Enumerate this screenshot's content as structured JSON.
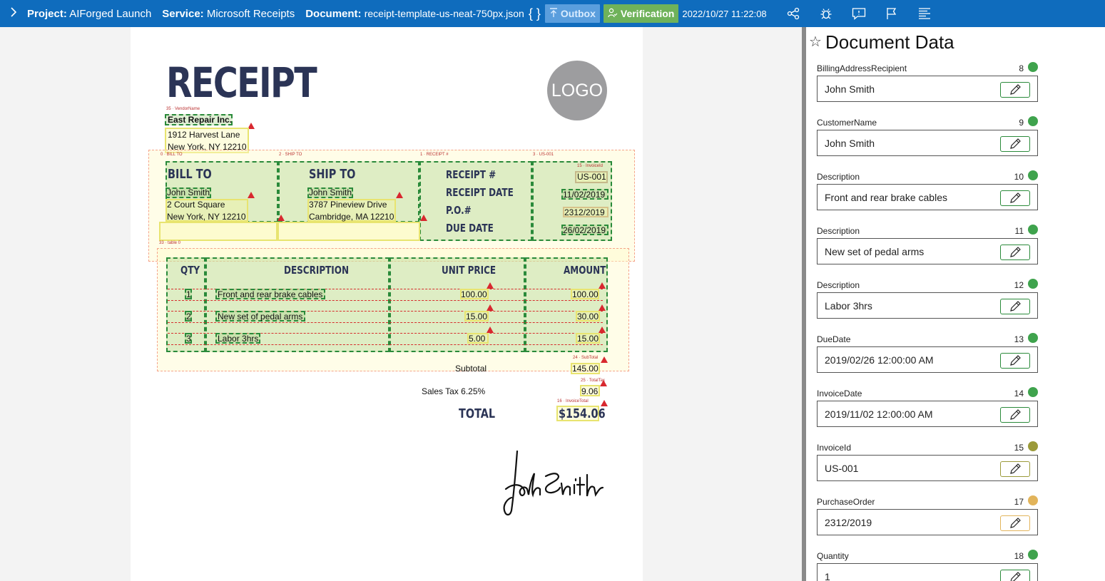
{
  "header": {
    "project_label": "Project:",
    "project": "AIForged Launch",
    "service_label": "Service:",
    "service": "Microsoft Receipts",
    "document_label": "Document:",
    "document": "receipt-template-us-neat-750px.json",
    "braces": "{ }",
    "outbox": "Outbox",
    "verification": "Verification",
    "timestamp": "2022/10/27 11:22:08"
  },
  "receipt": {
    "title": "RECEIPT",
    "logo": "LOGO",
    "vendor_name": "East Repair Inc.",
    "vendor_addr1": "1912 Harvest Lane",
    "vendor_addr2": "New York, NY 12210",
    "bill_to": "BILL TO",
    "ship_to": "SHIP TO",
    "receipt_no_label": "RECEIPT #",
    "receipt_date_label": "RECEIPT DATE",
    "po_label": "P.O.#",
    "due_date_label": "DUE DATE",
    "bill_name": "John Smith",
    "bill_addr1": "2 Court Square",
    "bill_addr2": "New York, NY 12210",
    "ship_name": "John Smith",
    "ship_addr1": "3787 Pineview Drive",
    "ship_addr2": "Cambridge, MA 12210",
    "receipt_no": "US-001",
    "receipt_date": "11/02/2019",
    "po": "2312/2019",
    "due_date": "26/02/2019",
    "col_qty": "QTY",
    "col_desc": "DESCRIPTION",
    "col_price": "UNIT PRICE",
    "col_amount": "AMOUNT",
    "items": [
      {
        "qty": "1",
        "desc": "Front and rear brake cables",
        "price": "100.00",
        "amount": "100.00"
      },
      {
        "qty": "2",
        "desc": "New set of pedal arms",
        "price": "15.00",
        "amount": "30.00"
      },
      {
        "qty": "3",
        "desc": "Labor 3hrs",
        "price": "5.00",
        "amount": "15.00"
      }
    ],
    "subtotal_label": "Subtotal",
    "subtotal": "145.00",
    "tax_label": "Sales Tax 6.25%",
    "tax": "9.06",
    "total_label": "TOTAL",
    "total": "$154.06",
    "tags": {
      "vendor": "35 · VendorName",
      "bill_to": "0 · BILL TO",
      "ship_to": "2 · SHIP TO",
      "receipt": "1 · RECEIPT #",
      "us": "3 · US-001",
      "invoice_id": "15 · InvoiceId",
      "table": "33 · table 0",
      "subtotal": "24 · SubTotal",
      "tax": "25 · TotalTax",
      "invoice_total": "16 · InvoiceTotal"
    }
  },
  "panel": {
    "title": "Document Data",
    "fields": [
      {
        "name": "BillingAddressRecipient",
        "num": "8",
        "value": "John Smith",
        "status": "#3fa34d"
      },
      {
        "name": "CustomerName",
        "num": "9",
        "value": "John Smith",
        "status": "#3fa34d"
      },
      {
        "name": "Description",
        "num": "10",
        "value": "Front and rear brake cables",
        "status": "#3fa34d"
      },
      {
        "name": "Description",
        "num": "11",
        "value": "New set of pedal arms",
        "status": "#3fa34d"
      },
      {
        "name": "Description",
        "num": "12",
        "value": "Labor 3hrs",
        "status": "#3fa34d"
      },
      {
        "name": "DueDate",
        "num": "13",
        "value": "2019/02/26 12:00:00 AM",
        "status": "#3fa34d"
      },
      {
        "name": "InvoiceDate",
        "num": "14",
        "value": "2019/11/02 12:00:00 AM",
        "status": "#3fa34d"
      },
      {
        "name": "InvoiceId",
        "num": "15",
        "value": "US-001",
        "status": "#9b9a3a"
      },
      {
        "name": "PurchaseOrder",
        "num": "17",
        "value": "2312/2019",
        "status": "#e2b45b"
      },
      {
        "name": "Quantity",
        "num": "18",
        "value": "1",
        "status": "#3fa34d"
      }
    ]
  },
  "icons": [
    "chevron-right-icon",
    "upload-icon",
    "person-check-icon",
    "share-icon",
    "bug-icon",
    "comment-icon",
    "flag-icon",
    "text-align-icon",
    "pencil-icon",
    "star-list-icon"
  ]
}
